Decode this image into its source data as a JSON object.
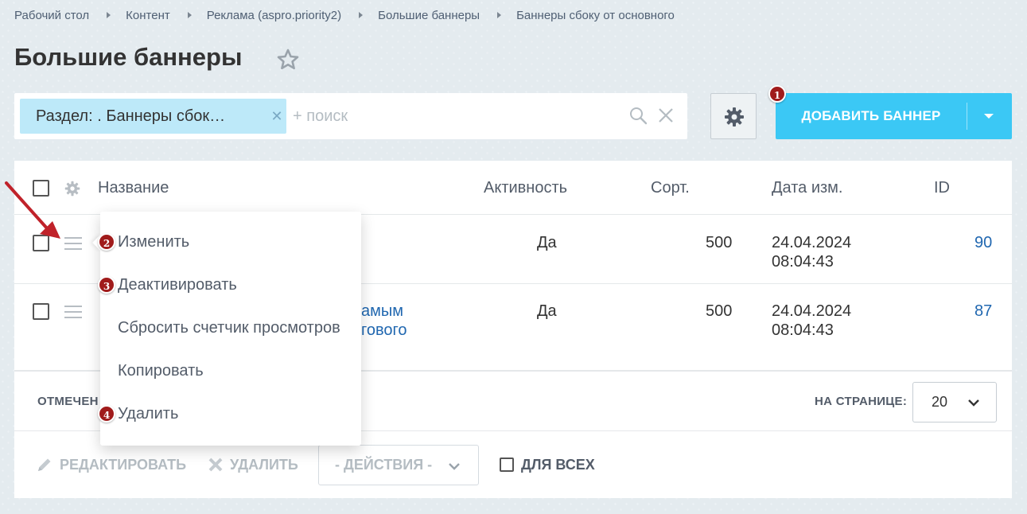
{
  "breadcrumb": [
    "Рабочий стол",
    "Контент",
    "Реклама (aspro.priority2)",
    "Большие баннеры",
    "Баннеры сбоку от основного"
  ],
  "page_title": "Большие баннеры",
  "filter": {
    "chip_label": "Раздел: . Баннеры сбок…",
    "search_placeholder": "+ поиск"
  },
  "add_button": {
    "label": "ДОБАВИТЬ БАННЕР"
  },
  "badges": [
    "1",
    "2",
    "3",
    "4"
  ],
  "table": {
    "columns": [
      "Название",
      "Активность",
      "Сорт.",
      "Дата изм.",
      "ID"
    ],
    "rows": [
      {
        "name_fragment": "",
        "active": "Да",
        "sort": "500",
        "date": "24.04.2024",
        "time": "08:04:43",
        "id": "90"
      },
      {
        "name_line1": "амым",
        "name_line2": "гового",
        "active": "Да",
        "sort": "500",
        "date": "24.04.2024",
        "time": "08:04:43",
        "id": "87"
      }
    ]
  },
  "footer": {
    "selected_label": "ОТМЕЧЕН",
    "per_page_label": "НА СТРАНИЦЕ:",
    "per_page_value": "20"
  },
  "actions": {
    "edit": "РЕДАКТИРОВАТЬ",
    "delete": "УДАЛИТЬ",
    "select_label": "- ДЕЙСТВИЯ -",
    "for_all": "ДЛЯ ВСЕХ"
  },
  "context_menu": {
    "items": [
      "Изменить",
      "Деактивировать",
      "Сбросить счетчик просмотров",
      "Копировать",
      "Удалить"
    ]
  },
  "colors": {
    "accent": "#3bc8f5",
    "chip": "#bde9f9",
    "badge": "#a01b1b",
    "link": "#2067b0",
    "arrow": "#c0222a"
  }
}
